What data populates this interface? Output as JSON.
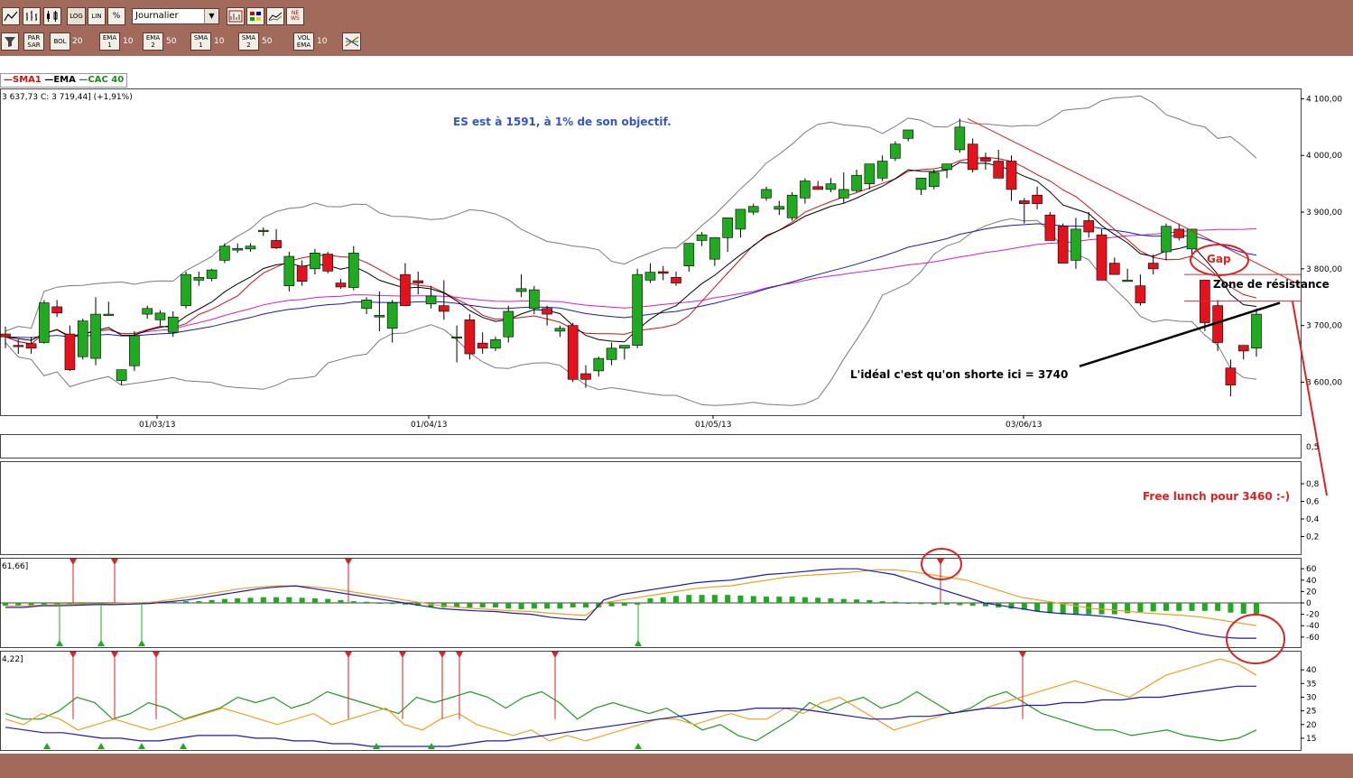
{
  "toolbar1": {
    "log_label": "LOG",
    "lin_label": "LIN",
    "pct_label": "%",
    "period_value": "Journalier",
    "news_label": "NE WS"
  },
  "toolbar2": {
    "parsar_label": "PAR SAR",
    "bol_label": "BOL",
    "bol_param": "20",
    "ema1_label": "EMA 1",
    "ema1_param": "10",
    "ema2_label": "EMA 2",
    "ema2_param": "50",
    "sma1_label": "SMA 1",
    "sma1_param": "10",
    "sma2_label": "SMA 2",
    "sma2_param": "50",
    "volema_label": "VOL EMA",
    "volema_param": "10"
  },
  "legend": {
    "sma1": "SMA1",
    "ema": "EMA",
    "cac40": "CAC 40",
    "quote": "3 637,73  C: 3 719,44] (+1,91%)"
  },
  "annotations": {
    "es_note": "ES est à 1591, à 1% de son objectif.",
    "gap": "Gap",
    "resistance": "Zone de résistance",
    "short_note": "L'idéal c'est qu'on shorte ici = 3740",
    "free_lunch": "Free lunch pour 3460 :-)"
  },
  "panel_labels": {
    "macd": "61,66]",
    "dmi": "4,22]"
  },
  "colors": {
    "bull": "#1faa1f",
    "bear": "#e3121b",
    "sma": "#cc1111",
    "ema": "#000000",
    "bollinger": "#7a7a7a",
    "ma50": "#d020d0",
    "ma_blue": "#1a1ab8",
    "note_blue": "#3355cc",
    "note_red": "#dd2222",
    "signal_orange": "#f0a020"
  },
  "chart_data": [
    {
      "type": "candlestick",
      "title": "CAC 40",
      "xlabel": "",
      "ylabel": "",
      "x_ticks": [
        "01/03/13",
        "01/04/13",
        "01/05/13",
        "03/06/13"
      ],
      "y_ticks": [
        "4 100,00",
        "4 000,00",
        "3 900,00",
        "3 800,00",
        "3 700,00",
        "3 600,00"
      ],
      "ylim": [
        3545,
        4115
      ],
      "candles": [
        [
          3685,
          3698,
          3660,
          3680
        ],
        [
          3665,
          3675,
          3650,
          3663
        ],
        [
          3668,
          3680,
          3650,
          3660
        ],
        [
          3670,
          3745,
          3668,
          3740
        ],
        [
          3733,
          3745,
          3715,
          3722
        ],
        [
          3685,
          3700,
          3620,
          3622
        ],
        [
          3645,
          3712,
          3640,
          3708
        ],
        [
          3642,
          3750,
          3630,
          3720
        ],
        [
          3720,
          3742,
          3719,
          3720
        ],
        [
          3603,
          3622,
          3595,
          3622
        ],
        [
          3629,
          3690,
          3620,
          3682
        ],
        [
          3720,
          3735,
          3712,
          3730
        ],
        [
          3710,
          3727,
          3700,
          3722
        ],
        [
          3688,
          3725,
          3680,
          3715
        ],
        [
          3735,
          3795,
          3730,
          3790
        ],
        [
          3780,
          3795,
          3770,
          3785
        ],
        [
          3783,
          3800,
          3778,
          3798
        ],
        [
          3815,
          3845,
          3810,
          3840
        ],
        [
          3833,
          3845,
          3828,
          3836
        ],
        [
          3835,
          3845,
          3830,
          3840
        ],
        [
          3868,
          3873,
          3858,
          3868
        ],
        [
          3850,
          3870,
          3835,
          3837
        ],
        [
          3770,
          3830,
          3760,
          3822
        ],
        [
          3805,
          3815,
          3770,
          3778
        ],
        [
          3800,
          3835,
          3790,
          3828
        ],
        [
          3826,
          3830,
          3792,
          3796
        ],
        [
          3775,
          3782,
          3765,
          3768
        ],
        [
          3767,
          3840,
          3762,
          3828
        ],
        [
          3730,
          3750,
          3720,
          3745
        ],
        [
          3715,
          3760,
          3690,
          3718
        ],
        [
          3695,
          3745,
          3670,
          3740
        ],
        [
          3790,
          3810,
          3735,
          3735
        ],
        [
          3779,
          3795,
          3755,
          3775
        ],
        [
          3738,
          3770,
          3730,
          3752
        ],
        [
          3735,
          3780,
          3710,
          3725
        ],
        [
          3680,
          3700,
          3635,
          3680
        ],
        [
          3710,
          3720,
          3640,
          3650
        ],
        [
          3669,
          3688,
          3650,
          3660
        ],
        [
          3660,
          3680,
          3655,
          3675
        ],
        [
          3680,
          3735,
          3670,
          3725
        ],
        [
          3760,
          3790,
          3750,
          3765
        ],
        [
          3730,
          3770,
          3720,
          3763
        ],
        [
          3730,
          3735,
          3700,
          3720
        ],
        [
          3690,
          3700,
          3680,
          3695
        ],
        [
          3700,
          3705,
          3600,
          3605
        ],
        [
          3615,
          3630,
          3590,
          3605
        ],
        [
          3620,
          3645,
          3610,
          3642
        ],
        [
          3640,
          3670,
          3630,
          3660
        ],
        [
          3660,
          3665,
          3640,
          3665
        ],
        [
          3665,
          3800,
          3660,
          3790
        ],
        [
          3780,
          3810,
          3775,
          3794
        ],
        [
          3795,
          3805,
          3780,
          3792
        ],
        [
          3785,
          3795,
          3770,
          3775
        ],
        [
          3805,
          3840,
          3795,
          3845
        ],
        [
          3850,
          3865,
          3840,
          3860
        ],
        [
          3817,
          3830,
          3805,
          3855
        ],
        [
          3855,
          3880,
          3830,
          3890
        ],
        [
          3870,
          3900,
          3855,
          3905
        ],
        [
          3900,
          3915,
          3895,
          3910
        ],
        [
          3925,
          3945,
          3920,
          3940
        ],
        [
          3905,
          3920,
          3895,
          3910
        ],
        [
          3890,
          3935,
          3885,
          3930
        ],
        [
          3925,
          3960,
          3915,
          3955
        ],
        [
          3945,
          3955,
          3940,
          3940
        ],
        [
          3940,
          3960,
          3935,
          3950
        ],
        [
          3925,
          3970,
          3915,
          3940
        ],
        [
          3938,
          3975,
          3935,
          3965
        ],
        [
          3950,
          3985,
          3940,
          3985
        ],
        [
          3960,
          4000,
          3955,
          3990
        ],
        [
          3995,
          4025,
          3990,
          4020
        ],
        [
          4030,
          4045,
          4025,
          4045
        ],
        [
          3940,
          3960,
          3930,
          3960
        ],
        [
          3945,
          3975,
          3940,
          3970
        ],
        [
          3975,
          3985,
          3960,
          3985
        ],
        [
          4010,
          4065,
          4005,
          4050
        ],
        [
          4020,
          4030,
          3970,
          3975
        ],
        [
          3995,
          4005,
          3975,
          3990
        ],
        [
          3990,
          4010,
          3960,
          3960
        ],
        [
          3990,
          4000,
          3920,
          3940
        ],
        [
          3920,
          3925,
          3880,
          3915
        ],
        [
          3930,
          3945,
          3905,
          3915
        ],
        [
          3895,
          3900,
          3865,
          3850
        ],
        [
          3875,
          3880,
          3850,
          3810
        ],
        [
          3815,
          3890,
          3800,
          3870
        ],
        [
          3885,
          3900,
          3855,
          3865
        ],
        [
          3860,
          3870,
          3800,
          3780
        ],
        [
          3810,
          3820,
          3795,
          3790
        ],
        [
          3780,
          3800,
          3780,
          3780
        ],
        [
          3770,
          3790,
          3735,
          3740
        ],
        [
          3810,
          3825,
          3790,
          3800
        ],
        [
          3830,
          3880,
          3815,
          3875
        ],
        [
          3870,
          3880,
          3850,
          3855
        ],
        [
          3835,
          3865,
          3820,
          3870
        ],
        [
          3780,
          3780,
          3690,
          3705
        ],
        [
          3735,
          3745,
          3655,
          3670
        ],
        [
          3625,
          3640,
          3575,
          3595
        ],
        [
          3665,
          3665,
          3640,
          3655
        ],
        [
          3660,
          3730,
          3645,
          3720
        ]
      ],
      "series": [
        {
          "name": "SMA1",
          "values": []
        },
        {
          "name": "EMA",
          "values": []
        }
      ]
    },
    {
      "type": "bar",
      "title": "",
      "y_ticks": [
        "0,5"
      ]
    },
    {
      "type": "line",
      "title": "",
      "y_ticks": [
        "0,8",
        "0,6",
        "0,4",
        "0,2"
      ]
    },
    {
      "type": "bar",
      "title": "",
      "y_ticks": [
        "60",
        "40",
        "20",
        "0",
        "-20",
        "-40",
        "-60"
      ],
      "ylim": [
        -65,
        65
      ],
      "histogram": [
        -5,
        -5,
        -5,
        -5,
        -3,
        -3,
        -3,
        -2,
        -2,
        -2,
        0,
        0,
        2,
        2,
        3,
        3,
        5,
        7,
        8,
        9,
        10,
        10,
        10,
        9,
        8,
        7,
        5,
        3,
        2,
        0,
        -2,
        -3,
        -5,
        -7,
        -8,
        -8,
        -8,
        -8,
        -8,
        -10,
        -11,
        -10,
        -10,
        -10,
        -8,
        -8,
        -8,
        -6,
        -5,
        -3,
        8,
        10,
        12,
        14,
        14,
        14,
        14,
        13,
        12,
        11,
        11,
        11,
        10,
        9,
        8,
        7,
        6,
        5,
        3,
        2,
        0,
        -2,
        -3,
        -3,
        -4,
        -5,
        -6,
        -8,
        -10,
        -12,
        -15,
        -18,
        -20,
        -20,
        -20,
        -20,
        -20,
        -18,
        -16,
        -15,
        -14,
        -14,
        -14,
        -14,
        -14,
        -17,
        -19,
        -19
      ],
      "line_blue": [
        -8,
        -8,
        -5,
        -5,
        -4,
        -3,
        -3,
        -2,
        -1,
        2,
        5,
        10,
        15,
        20,
        25,
        28,
        30,
        25,
        20,
        15,
        10,
        5,
        0,
        -5,
        -10,
        -12,
        -14,
        -15,
        -18,
        -20,
        -25,
        -28,
        -30,
        5,
        15,
        20,
        25,
        30,
        35,
        38,
        40,
        45,
        50,
        52,
        55,
        58,
        60,
        60,
        55,
        50,
        40,
        30,
        20,
        10,
        0,
        -5,
        -10,
        -15,
        -18,
        -20,
        -22,
        -25,
        -30,
        -35,
        -40,
        -48,
        -55,
        -60,
        -62,
        -62
      ],
      "line_orange": [
        -5,
        -5,
        -4,
        -3,
        -2,
        -2,
        -1,
        0,
        1,
        5,
        10,
        15,
        20,
        25,
        28,
        30,
        30,
        28,
        25,
        20,
        15,
        10,
        5,
        0,
        -5,
        -8,
        -10,
        -12,
        -14,
        -15,
        -18,
        -20,
        -22,
        0,
        5,
        10,
        15,
        20,
        25,
        28,
        30,
        35,
        40,
        45,
        48,
        50,
        52,
        55,
        58,
        58,
        55,
        50,
        45,
        40,
        30,
        20,
        10,
        5,
        0,
        -5,
        -10,
        -12,
        -15,
        -18,
        -20,
        -22,
        -25,
        -30,
        -35,
        -40
      ],
      "signals_down": [
        "02/13",
        "02/13",
        "03/13",
        "05/13"
      ],
      "signals_up": [
        "02/13",
        "02/13",
        "03/13",
        "04/13"
      ]
    },
    {
      "type": "line",
      "title": "",
      "y_ticks": [
        "40",
        "35",
        "30",
        "25",
        "20",
        "15"
      ],
      "ylim": [
        12,
        45
      ],
      "series": [
        {
          "name": "",
          "values": [
            24,
            22,
            22,
            25,
            30,
            28,
            22,
            24,
            28,
            26,
            22,
            24,
            26,
            30,
            28,
            30,
            26,
            28,
            32,
            30,
            28,
            26,
            24,
            30,
            28,
            30,
            32,
            30,
            26,
            30,
            32,
            28,
            22,
            26,
            28,
            26,
            24,
            26,
            22,
            18,
            20,
            16,
            14,
            18,
            22,
            28,
            25,
            28,
            30,
            26,
            28,
            32,
            28,
            24,
            26,
            30,
            32,
            28,
            24,
            22,
            20,
            18,
            18,
            16,
            17,
            18,
            16,
            15,
            14,
            15,
            18
          ]
        },
        {
          "name": "",
          "values": [
            22,
            20,
            24,
            22,
            18,
            20,
            22,
            20,
            18,
            20,
            22,
            24,
            26,
            24,
            22,
            20,
            22,
            24,
            20,
            22,
            24,
            26,
            20,
            18,
            22,
            24,
            20,
            18,
            16,
            18,
            14,
            16,
            14,
            16,
            18,
            20,
            22,
            22,
            20,
            22,
            24,
            22,
            22,
            26,
            24,
            28,
            30,
            26,
            22,
            18,
            20,
            22,
            24,
            25,
            26,
            28,
            30,
            32,
            34,
            36,
            34,
            32,
            30,
            34,
            38,
            40,
            42,
            44,
            42,
            38
          ]
        },
        {
          "name": "",
          "values": [
            19,
            18,
            17,
            17,
            16,
            15,
            15,
            14,
            14,
            15,
            16,
            16,
            16,
            15,
            15,
            14,
            14,
            13,
            13,
            12,
            12,
            12,
            12,
            12,
            13,
            14,
            14,
            15,
            16,
            17,
            18,
            19,
            20,
            21,
            22,
            23,
            24,
            25,
            25,
            26,
            26,
            26,
            25,
            24,
            23,
            22,
            22,
            23,
            23,
            24,
            25,
            26,
            26,
            27,
            27,
            28,
            28,
            29,
            29,
            30,
            30,
            31,
            32,
            33,
            34,
            34
          ]
        }
      ]
    }
  ]
}
